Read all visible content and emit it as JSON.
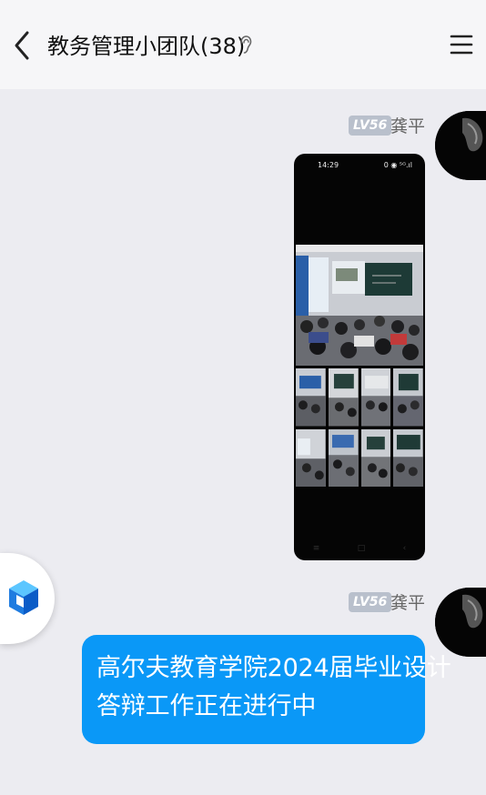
{
  "header": {
    "title": "教务管理小团队(38)",
    "back_icon": "chevron-left-icon",
    "ear_icon": "ear-icon",
    "menu_icon": "menu-icon"
  },
  "messages": [
    {
      "sender": "龚平",
      "level": "LV56",
      "type": "image",
      "image": {
        "status_time": "14:29",
        "status_right": "0 ◉ ⁵ᴳ.ıl",
        "nav_icons": [
          "≡",
          "□",
          "‹"
        ]
      }
    },
    {
      "sender": "龚平",
      "level": "LV56",
      "type": "text",
      "lines": [
        "高尔夫教育学院2024届毕业设计",
        "答辩工作正在进行中"
      ]
    }
  ],
  "floating_widget": {
    "icon": "cube-icon"
  },
  "colors": {
    "bubble": "#0a98f7",
    "background": "#ececf1",
    "header": "#f6f6f8",
    "badge": "#b9c0cc"
  }
}
